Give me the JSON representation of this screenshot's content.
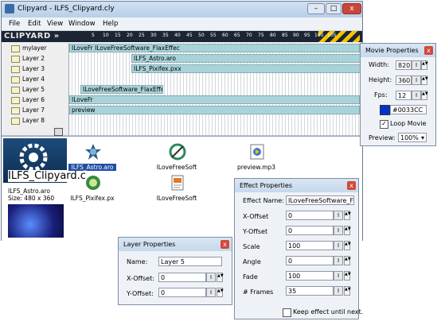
{
  "window": {
    "title": "Clipyard - ILFS_Clipyard.cly",
    "minimize": "–",
    "maximize": "□",
    "close": "x"
  },
  "menu": [
    "File",
    "Edit",
    "View",
    "Window",
    "Help"
  ],
  "timeline": {
    "logo": "CLIPYARD »",
    "ticks": [
      "5",
      "10",
      "15",
      "20",
      "25",
      "30",
      "35",
      "40",
      "45",
      "50",
      "55",
      "60",
      "65",
      "70",
      "75",
      "80",
      "85",
      "90",
      "95",
      "100",
      "105"
    ]
  },
  "layers": [
    {
      "name": "mylayer",
      "clip": "ILoveFr ILoveFreeSoftware_FlaxEffec"
    },
    {
      "name": "Layer 2",
      "clip": "ILFS_Astro.aro"
    },
    {
      "name": "Layer 3",
      "clip": "ILFS_Pixifex.pxx"
    },
    {
      "name": "Layer 4",
      "clip": ""
    },
    {
      "name": "Layer 5",
      "clip": "ILoveFreeSoftware_FlaxEffec"
    },
    {
      "name": "Layer 6",
      "clip": "ILoveFr"
    },
    {
      "name": "Layer 7",
      "clip": "preview"
    },
    {
      "name": "Layer 8",
      "clip": ""
    }
  ],
  "preview": {
    "title": "ILFS_Clipyard.c",
    "file": "ILFS_Astro.aro",
    "size": "Size: 480 x 360"
  },
  "library": [
    {
      "label": "ILFS_Astro.aro",
      "icon": "astro-icon"
    },
    {
      "label": "ILoveFreeSoft",
      "icon": "flax-icon"
    },
    {
      "label": "preview.mp3",
      "icon": "audio-icon"
    },
    {
      "label": "ILFS_Pixifex.px",
      "icon": "pixifex-icon"
    },
    {
      "label": "ILoveFreeSoft",
      "icon": "script-icon"
    }
  ],
  "movie": {
    "title": "Movie Properties",
    "width_label": "Width:",
    "width": "820",
    "height_label": "Height:",
    "height": "360",
    "fps_label": "Fps:",
    "fps": "12",
    "color": "#0033CC",
    "loop_label": "Loop Movie",
    "preview_label": "Preview:",
    "preview": "100%"
  },
  "effect": {
    "title": "Effect Properties",
    "name_label": "Effect Name:",
    "name": "ILoveFreeSoftware_Fla",
    "xoff_label": "X-Offset",
    "xoff": "0",
    "yoff_label": "Y-Offset",
    "yoff": "0",
    "scale_label": "Scale",
    "scale": "100",
    "angle_label": "Angle",
    "angle": "0",
    "fade_label": "Fade",
    "fade": "100",
    "frames_label": "# Frames",
    "frames": "35",
    "keep_label": "Keep effect until next."
  },
  "layerprops": {
    "title": "Layer Properties",
    "name_label": "Name:",
    "name": "Layer 5",
    "xoff_label": "X-Offset:",
    "xoff": "0",
    "yoff_label": "Y-Offset:",
    "yoff": "0"
  }
}
